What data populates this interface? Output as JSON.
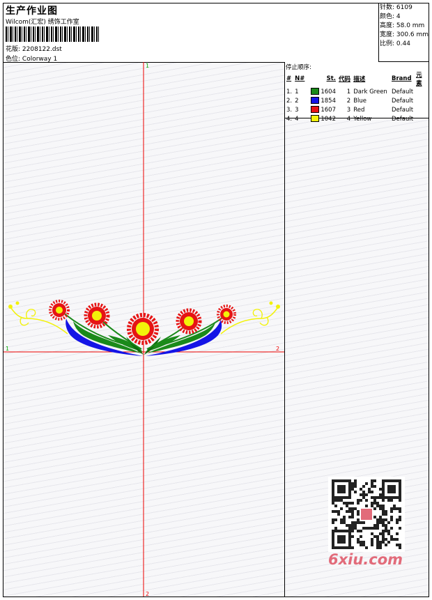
{
  "header": {
    "title": "生产作业图",
    "studio": "Wilcom(汇宏) 绣饰工作室",
    "design_label": "花版:",
    "design_file": "2208122.dst",
    "colorway_label": "色位:",
    "colorway": "Colorway 1"
  },
  "stats": {
    "stitches": "针数: 6109",
    "colors": "颜色: 4",
    "height": "高度: 58.0 mm",
    "width": "宽度: 300.6 mm",
    "scale": "比例: 0.44"
  },
  "axes": {
    "top": "1",
    "bottom": "2",
    "left": "1",
    "right": "2"
  },
  "stop_sequence": {
    "caption": "停止顺序:",
    "headers": [
      "#",
      "N#",
      "St.",
      "代码",
      "描述",
      "Brand",
      "元素"
    ],
    "rows": [
      {
        "num": "1.",
        "n": "1",
        "color": "#1a8a1a",
        "st": "1604",
        "code": "1",
        "desc": "Dark Green",
        "brand": "Default"
      },
      {
        "num": "2.",
        "n": "2",
        "color": "#1414e6",
        "st": "1854",
        "code": "2",
        "desc": "Blue",
        "brand": "Default"
      },
      {
        "num": "3.",
        "n": "3",
        "color": "#e61414",
        "st": "1607",
        "code": "3",
        "desc": "Red",
        "brand": "Default"
      },
      {
        "num": "4.",
        "n": "4",
        "color": "#f2f20a",
        "st": "1042",
        "code": "4",
        "desc": "Yellow",
        "brand": "Default"
      }
    ]
  },
  "watermark": {
    "text": "6xiu.com"
  }
}
